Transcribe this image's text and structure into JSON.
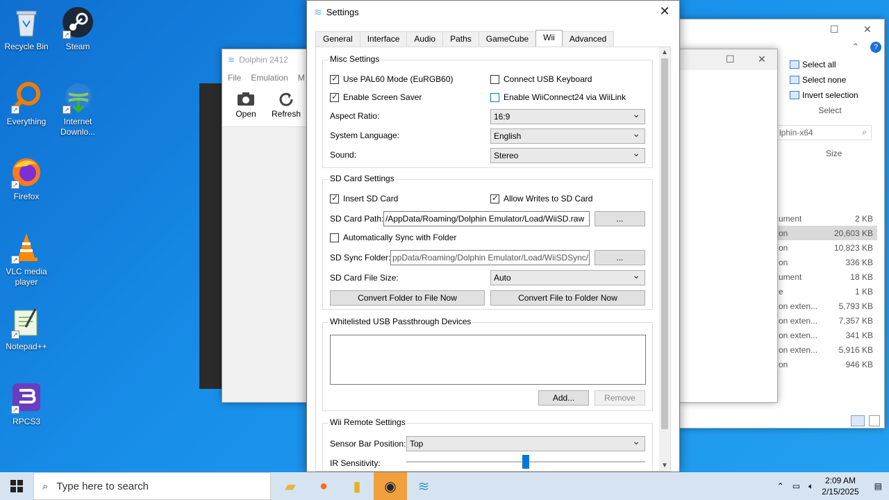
{
  "desktop": {
    "icons": [
      {
        "label": "Recycle Bin"
      },
      {
        "label": "Steam"
      },
      {
        "label": "Everything"
      },
      {
        "label": "Internet Downlo..."
      },
      {
        "label": "Firefox"
      },
      {
        "label": "VLC media player"
      },
      {
        "label": "Notepad++"
      },
      {
        "label": "RPCS3"
      }
    ]
  },
  "dolphin_main": {
    "title": "Dolphin 2412",
    "menu": [
      "File",
      "Emulation",
      "M"
    ],
    "toolbar": [
      {
        "label": "Open"
      },
      {
        "label": "Refresh"
      }
    ]
  },
  "explorer": {
    "ribbon": [
      "Select all",
      "Select none",
      "Invert selection"
    ],
    "ribbon_group": "Select",
    "address": "lphin-x64",
    "size_header": "Size",
    "rows": [
      {
        "name": "ument",
        "size": "2 KB"
      },
      {
        "name": "on",
        "size": "20,603 KB"
      },
      {
        "name": "on",
        "size": "10,823 KB"
      },
      {
        "name": "on",
        "size": "336 KB"
      },
      {
        "name": "ument",
        "size": "18 KB"
      },
      {
        "name": "e",
        "size": "1 KB"
      },
      {
        "name": "on exten...",
        "size": "5,793 KB"
      },
      {
        "name": "on exten...",
        "size": "7,357 KB"
      },
      {
        "name": "on exten...",
        "size": "341 KB"
      },
      {
        "name": "on exten...",
        "size": "5,916 KB"
      },
      {
        "name": "on",
        "size": "946 KB"
      }
    ]
  },
  "settings": {
    "title": "Settings",
    "tabs": [
      "General",
      "Interface",
      "Audio",
      "Paths",
      "GameCube",
      "Wii",
      "Advanced"
    ],
    "misc": {
      "title": "Misc Settings",
      "pal60": "Use PAL60 Mode (EuRGB60)",
      "usb_keyboard": "Connect USB Keyboard",
      "screen_saver": "Enable Screen Saver",
      "wiiconnect": "Enable WiiConnect24 via WiiLink",
      "aspect_label": "Aspect Ratio:",
      "aspect_value": "16:9",
      "language_label": "System Language:",
      "language_value": "English",
      "sound_label": "Sound:",
      "sound_value": "Stereo"
    },
    "sd": {
      "title": "SD Card Settings",
      "insert": "Insert SD Card",
      "allow_writes": "Allow Writes to SD Card",
      "path_label": "SD Card Path:",
      "path_value": "/AppData/Roaming/Dolphin Emulator/Load/WiiSD.raw",
      "browse": "...",
      "auto_sync": "Automatically Sync with Folder",
      "sync_label": "SD Sync Folder:",
      "sync_value": "ppData/Roaming/Dolphin Emulator/Load/WiiSDSync/",
      "size_label": "SD Card File Size:",
      "size_value": "Auto",
      "convert_to_file": "Convert Folder to File Now",
      "convert_to_folder": "Convert File to Folder Now"
    },
    "usb": {
      "title": "Whitelisted USB Passthrough Devices",
      "add": "Add...",
      "remove": "Remove"
    },
    "remote": {
      "title": "Wii Remote Settings",
      "sensor_label": "Sensor Bar Position:",
      "sensor_value": "Top",
      "ir_label": "IR Sensitivity:",
      "ir_level": 0.5
    }
  },
  "taskbar": {
    "search_placeholder": "Type here to search",
    "time": "2:09 AM",
    "date": "2/15/2025"
  }
}
